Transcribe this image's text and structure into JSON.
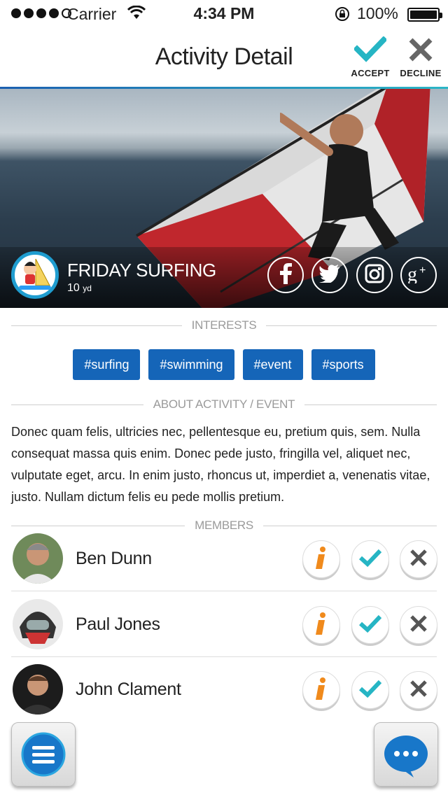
{
  "status_bar": {
    "carrier": "Carrier",
    "time": "4:34 PM",
    "battery": "100%",
    "signal_dots_filled": 4,
    "signal_dots_total": 5
  },
  "nav": {
    "title": "Activity Detail",
    "accept_label": "ACCEPT",
    "decline_label": "DECLINE"
  },
  "event": {
    "title": "FRIDAY SURFING",
    "distance_value": "10",
    "distance_unit": "yd",
    "social": [
      "facebook-icon",
      "twitter-icon",
      "instagram-icon",
      "google-plus-icon"
    ]
  },
  "sections": {
    "interests": "INTERESTS",
    "about": "ABOUT ACTIVITY / EVENT",
    "members": "MEMBERS"
  },
  "interests": [
    "#surfing",
    "#swimming",
    "#event",
    "#sports"
  ],
  "about_text": "Donec quam felis, ultricies nec, pellentesque eu, pretium quis, sem. Nulla consequat massa quis enim. Donec pede justo, fringilla vel, aliquet nec, vulputate eget, arcu. In enim justo, rhoncus ut, imperdiet a, venenatis vitae, justo. Nullam dictum felis eu pede mollis pretium.",
  "members": [
    {
      "name": "Ben Dunn"
    },
    {
      "name": "Paul Jones"
    },
    {
      "name": "John Clament"
    }
  ],
  "colors": {
    "accent_blue": "#1565b8",
    "teal": "#26b5c4",
    "orange": "#f08a1c",
    "grey_icon": "#555555"
  },
  "icons": {
    "menu": "menu-icon",
    "chat": "chat-bubble-icon"
  }
}
